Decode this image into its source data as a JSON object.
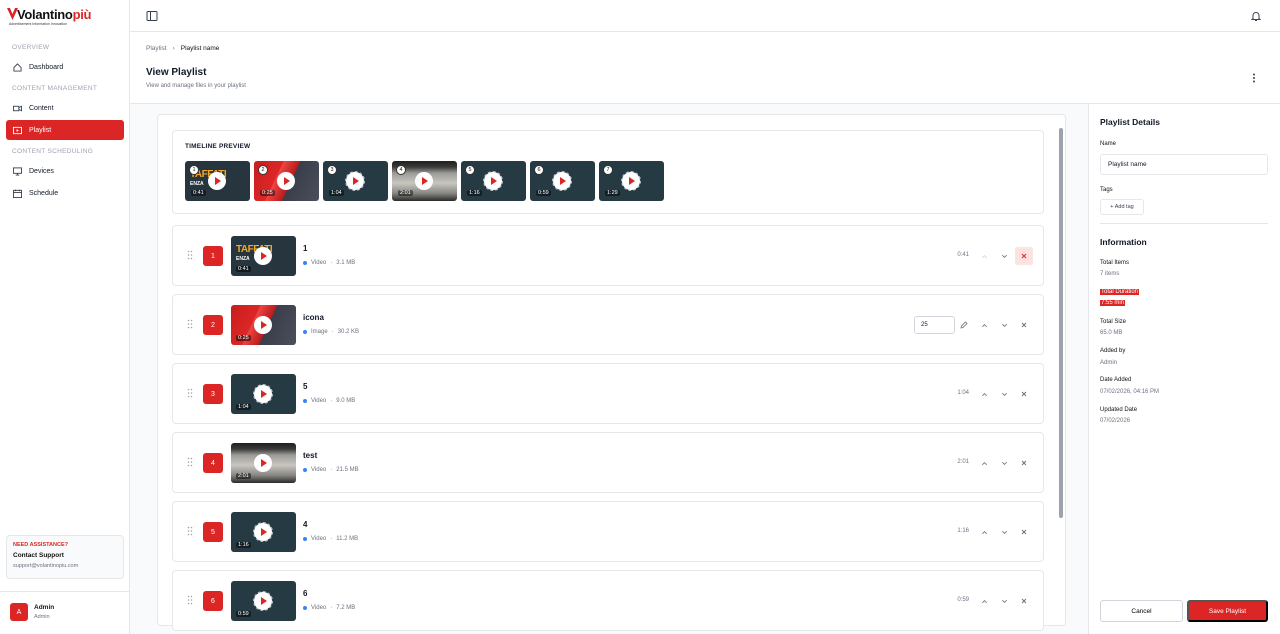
{
  "brand": {
    "name_a": "Volantino",
    "name_b": "più",
    "tagline": "Advertisement Information Innovation",
    "red": "#dc2626"
  },
  "sidebar": {
    "sections": [
      "OVERVIEW",
      "CONTENT MANAGEMENT",
      "CONTENT SCHEDULING"
    ],
    "items": [
      {
        "label": "Dashboard",
        "icon": "home-icon"
      },
      {
        "label": "Content",
        "icon": "video-icon"
      },
      {
        "label": "Playlist",
        "icon": "playlist-icon",
        "active": true
      },
      {
        "label": "Devices",
        "icon": "monitor-icon"
      },
      {
        "label": "Schedule",
        "icon": "calendar-icon"
      }
    ],
    "assist": {
      "title": "NEED ASSISTANCE?",
      "subtitle": "Contact Support",
      "email": "support@volantinopiu.com"
    },
    "user": {
      "initial": "A",
      "name": "Admin",
      "role": "Admin"
    }
  },
  "breadcrumb": {
    "root": "Playlist",
    "current": "Playlist name"
  },
  "page": {
    "title": "View Playlist",
    "subtitle": "View and manage files in your playlist"
  },
  "timeline": {
    "title": "TIMELINE PREVIEW",
    "items": [
      {
        "num": "1",
        "dur": "0:41",
        "art": "tv"
      },
      {
        "num": "2",
        "dur": "0:25",
        "art": "red"
      },
      {
        "num": "3",
        "dur": "1:04",
        "art": "dark"
      },
      {
        "num": "4",
        "dur": "2:01",
        "art": "photo"
      },
      {
        "num": "5",
        "dur": "1:16",
        "art": "dark"
      },
      {
        "num": "6",
        "dur": "0:59",
        "art": "dark"
      },
      {
        "num": "7",
        "dur": "1:29",
        "art": "dark"
      }
    ]
  },
  "rows": [
    {
      "num": "1",
      "title": "1",
      "type": "Video",
      "size": "3.1 MB",
      "dur": "0:41",
      "art": "tv",
      "time": "0:41"
    },
    {
      "num": "2",
      "title": "icona",
      "type": "Image",
      "size": "30.2 KB",
      "dur": "0:25",
      "art": "red",
      "input": "25"
    },
    {
      "num": "3",
      "title": "5",
      "type": "Video",
      "size": "9.0 MB",
      "dur": "1:04",
      "art": "dark",
      "time": "1:04"
    },
    {
      "num": "4",
      "title": "test",
      "type": "Video",
      "size": "21.5 MB",
      "dur": "2:01",
      "art": "photo",
      "time": "2:01"
    },
    {
      "num": "5",
      "title": "4",
      "type": "Video",
      "size": "11.2 MB",
      "dur": "1:16",
      "art": "dark",
      "time": "1:16"
    },
    {
      "num": "6",
      "title": "6",
      "type": "Video",
      "size": "7.2 MB",
      "dur": "0:59",
      "art": "dark",
      "time": "0:59"
    }
  ],
  "details": {
    "title": "Playlist Details",
    "name_label": "Name",
    "name_value": "Playlist name",
    "tags_label": "Tags",
    "add_tag": "+ Add tag"
  },
  "info": {
    "title": "Information",
    "total_items_label": "Total Items",
    "total_items": "7 items",
    "total_duration_label": "Total Duration",
    "total_duration": "7:55 min",
    "total_size_label": "Total Size",
    "total_size": "65.0 MB",
    "added_by_label": "Added by",
    "added_by": "Admin",
    "date_added_label": "Date Added",
    "date_added": "07/02/2026, 04:16 PM",
    "updated_label": "Updated Date",
    "updated": "07/02/2026"
  },
  "actions": {
    "cancel": "Cancel",
    "save": "Save Playlist"
  }
}
